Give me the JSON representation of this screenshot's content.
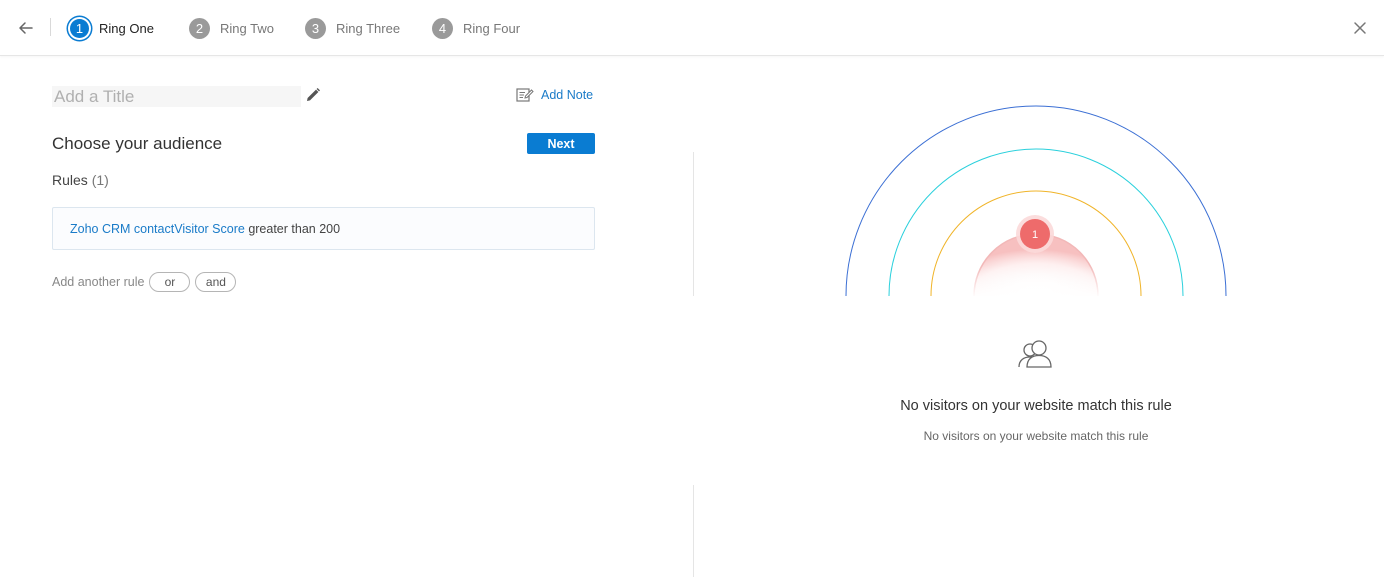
{
  "header": {
    "back_icon": "back-arrow-icon",
    "close_icon": "close-icon",
    "steps": [
      {
        "num": "1",
        "label": "Ring One",
        "active": true
      },
      {
        "num": "2",
        "label": "Ring Two",
        "active": false
      },
      {
        "num": "3",
        "label": "Ring Three",
        "active": false
      },
      {
        "num": "4",
        "label": "Ring Four",
        "active": false
      }
    ]
  },
  "editor": {
    "title_placeholder": "Add a Title",
    "title_value": "",
    "add_note_label": "Add Note",
    "section_title": "Choose your audience",
    "next_label": "Next",
    "rules_label": "Rules",
    "rules_count": "(1)",
    "rule": {
      "field": "Zoho CRM contactVisitor Score",
      "condition": " greater than 200"
    },
    "add_rule_label": "Add another rule",
    "or_label": "or",
    "and_label": "and"
  },
  "preview": {
    "ring_colors": [
      "#3b6fd4",
      "#2ad0dc",
      "#f0b429",
      "#f2b8b8"
    ],
    "marker_count": "1",
    "marker_color": "#ee6b6b",
    "empty_title": "No visitors on your website match this rule",
    "empty_subtitle": "No visitors on your website match this rule"
  }
}
